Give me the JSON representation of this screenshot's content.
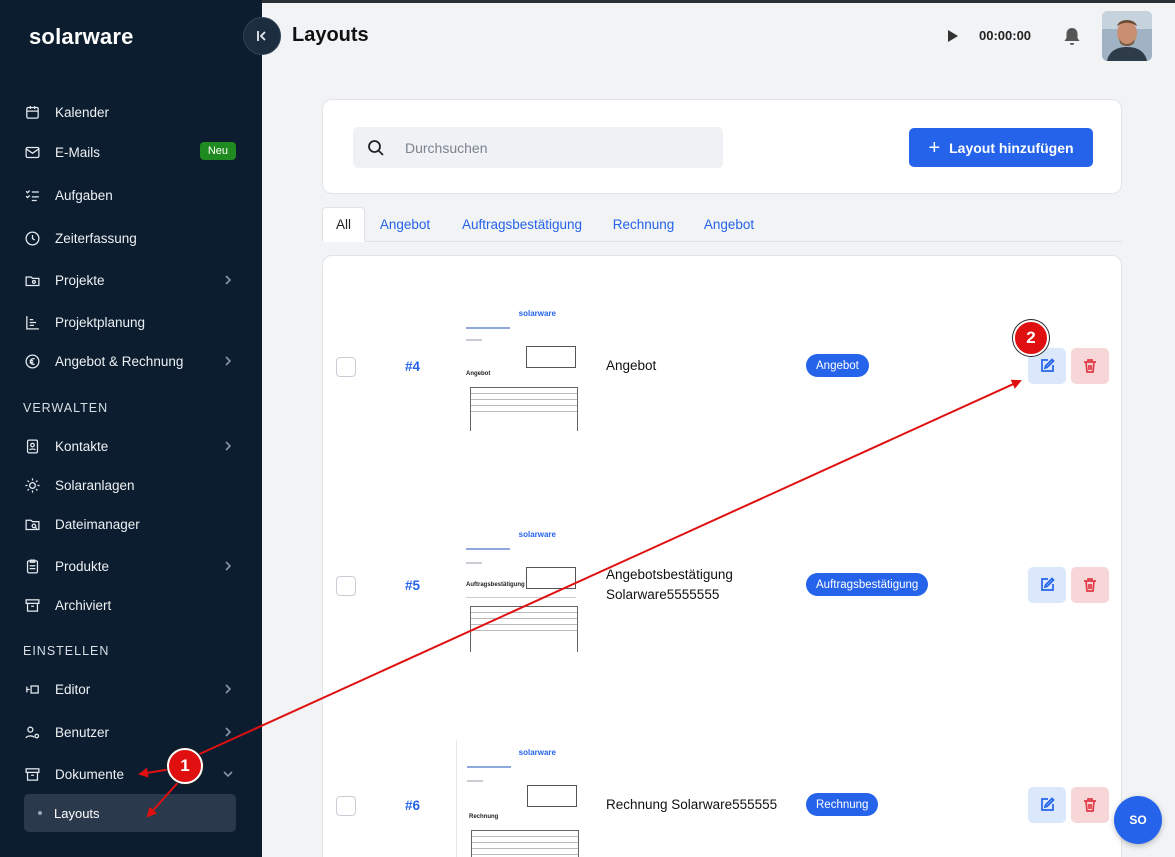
{
  "app": {
    "brand": "solarware",
    "page_title": "Layouts"
  },
  "header": {
    "timer": "00:00:00"
  },
  "sidebar": {
    "items": [
      {
        "label": "Kalender",
        "icon": "calendar-icon"
      },
      {
        "label": "E-Mails",
        "icon": "mail-icon",
        "badge": "Neu"
      },
      {
        "label": "Aufgaben",
        "icon": "tasks-icon"
      },
      {
        "label": "Zeiterfassung",
        "icon": "clock-icon"
      },
      {
        "label": "Projekte",
        "icon": "folder-icon"
      },
      {
        "label": "Projektplanung",
        "icon": "gantt-icon"
      },
      {
        "label": "Angebot & Rechnung",
        "icon": "euro-icon"
      }
    ],
    "section_manage": "VERWALTEN",
    "manage_items": [
      {
        "label": "Kontakte",
        "icon": "contact-icon"
      },
      {
        "label": "Solaranlagen",
        "icon": "sun-icon"
      },
      {
        "label": "Dateimanager",
        "icon": "folder-search-icon"
      },
      {
        "label": "Produkte",
        "icon": "clipboard-icon"
      },
      {
        "label": "Archiviert",
        "icon": "archive-icon"
      }
    ],
    "section_settings": "EINSTELLEN",
    "settings_items": [
      {
        "label": "Editor",
        "icon": "editor-icon"
      },
      {
        "label": "Benutzer",
        "icon": "user-settings-icon"
      },
      {
        "label": "Dokumente",
        "icon": "documents-icon"
      }
    ],
    "sub_active": "Layouts"
  },
  "search": {
    "placeholder": "Durchsuchen"
  },
  "toolbar": {
    "add_label": "Layout hinzufügen"
  },
  "tabs": [
    "All",
    "Angebot",
    "Auftragsbestätigung",
    "Rechnung",
    "Angebot"
  ],
  "rows": [
    {
      "id": "#4",
      "name": "Angebot",
      "type": "Angebot",
      "thumb_title": "Angebot"
    },
    {
      "id": "#5",
      "name": "Angebotsbestätigung Solarware5555555",
      "type": "Auftragsbestätigung",
      "thumb_title": "Auftragsbestätigung"
    },
    {
      "id": "#6",
      "name": "Rechnung Solarware555555",
      "type": "Rechnung",
      "thumb_title": "Rechnung"
    }
  ],
  "thumb_logo": "solarware",
  "fab": "SO",
  "annotations": {
    "marker1": "1",
    "marker2": "2",
    "color": "#e01010"
  }
}
